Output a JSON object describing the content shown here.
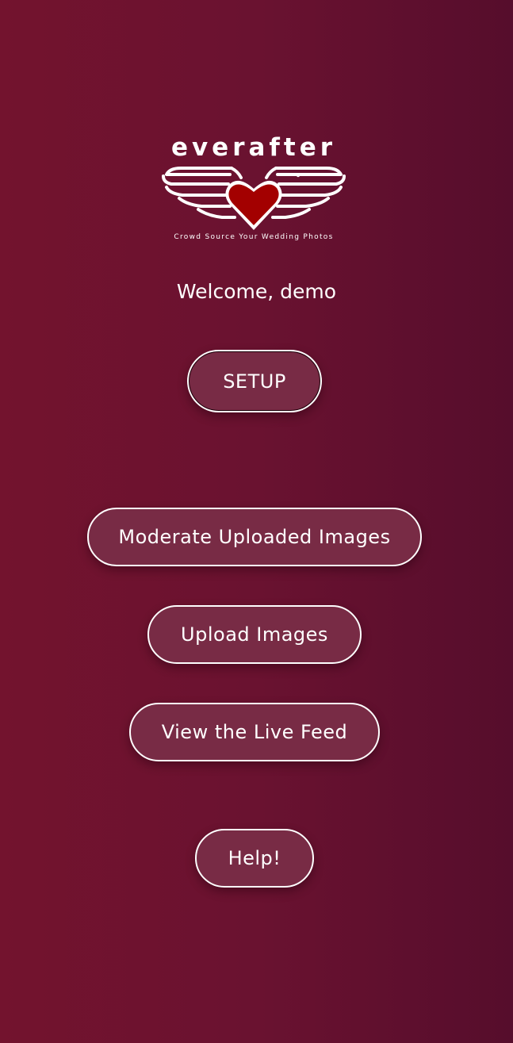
{
  "brand": {
    "name": "everafter",
    "tagline": "Crowd Source Your Wedding Photos",
    "logo_icon": "winged-heart-icon",
    "heart_color": "#a30000"
  },
  "welcome_text": "Welcome, demo",
  "buttons": {
    "setup": "SETUP",
    "moderate": "Moderate Uploaded Images",
    "upload": "Upload Images",
    "live_feed": "View the Live Feed",
    "help": "Help!"
  },
  "colors": {
    "background_start": "#73132e",
    "background_end": "#560d2c",
    "button_fill": "#782b45",
    "button_border": "#ffffff",
    "text": "#ffffff"
  }
}
